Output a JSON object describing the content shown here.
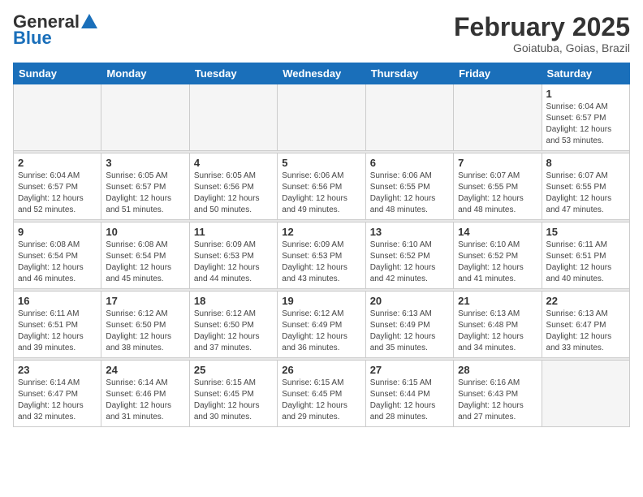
{
  "header": {
    "logo_general": "General",
    "logo_blue": "Blue",
    "month_title": "February 2025",
    "location": "Goiatuba, Goias, Brazil"
  },
  "weekdays": [
    "Sunday",
    "Monday",
    "Tuesday",
    "Wednesday",
    "Thursday",
    "Friday",
    "Saturday"
  ],
  "weeks": [
    [
      {
        "day": "",
        "info": ""
      },
      {
        "day": "",
        "info": ""
      },
      {
        "day": "",
        "info": ""
      },
      {
        "day": "",
        "info": ""
      },
      {
        "day": "",
        "info": ""
      },
      {
        "day": "",
        "info": ""
      },
      {
        "day": "1",
        "info": "Sunrise: 6:04 AM\nSunset: 6:57 PM\nDaylight: 12 hours and 53 minutes."
      }
    ],
    [
      {
        "day": "2",
        "info": "Sunrise: 6:04 AM\nSunset: 6:57 PM\nDaylight: 12 hours and 52 minutes."
      },
      {
        "day": "3",
        "info": "Sunrise: 6:05 AM\nSunset: 6:57 PM\nDaylight: 12 hours and 51 minutes."
      },
      {
        "day": "4",
        "info": "Sunrise: 6:05 AM\nSunset: 6:56 PM\nDaylight: 12 hours and 50 minutes."
      },
      {
        "day": "5",
        "info": "Sunrise: 6:06 AM\nSunset: 6:56 PM\nDaylight: 12 hours and 49 minutes."
      },
      {
        "day": "6",
        "info": "Sunrise: 6:06 AM\nSunset: 6:55 PM\nDaylight: 12 hours and 48 minutes."
      },
      {
        "day": "7",
        "info": "Sunrise: 6:07 AM\nSunset: 6:55 PM\nDaylight: 12 hours and 48 minutes."
      },
      {
        "day": "8",
        "info": "Sunrise: 6:07 AM\nSunset: 6:55 PM\nDaylight: 12 hours and 47 minutes."
      }
    ],
    [
      {
        "day": "9",
        "info": "Sunrise: 6:08 AM\nSunset: 6:54 PM\nDaylight: 12 hours and 46 minutes."
      },
      {
        "day": "10",
        "info": "Sunrise: 6:08 AM\nSunset: 6:54 PM\nDaylight: 12 hours and 45 minutes."
      },
      {
        "day": "11",
        "info": "Sunrise: 6:09 AM\nSunset: 6:53 PM\nDaylight: 12 hours and 44 minutes."
      },
      {
        "day": "12",
        "info": "Sunrise: 6:09 AM\nSunset: 6:53 PM\nDaylight: 12 hours and 43 minutes."
      },
      {
        "day": "13",
        "info": "Sunrise: 6:10 AM\nSunset: 6:52 PM\nDaylight: 12 hours and 42 minutes."
      },
      {
        "day": "14",
        "info": "Sunrise: 6:10 AM\nSunset: 6:52 PM\nDaylight: 12 hours and 41 minutes."
      },
      {
        "day": "15",
        "info": "Sunrise: 6:11 AM\nSunset: 6:51 PM\nDaylight: 12 hours and 40 minutes."
      }
    ],
    [
      {
        "day": "16",
        "info": "Sunrise: 6:11 AM\nSunset: 6:51 PM\nDaylight: 12 hours and 39 minutes."
      },
      {
        "day": "17",
        "info": "Sunrise: 6:12 AM\nSunset: 6:50 PM\nDaylight: 12 hours and 38 minutes."
      },
      {
        "day": "18",
        "info": "Sunrise: 6:12 AM\nSunset: 6:50 PM\nDaylight: 12 hours and 37 minutes."
      },
      {
        "day": "19",
        "info": "Sunrise: 6:12 AM\nSunset: 6:49 PM\nDaylight: 12 hours and 36 minutes."
      },
      {
        "day": "20",
        "info": "Sunrise: 6:13 AM\nSunset: 6:49 PM\nDaylight: 12 hours and 35 minutes."
      },
      {
        "day": "21",
        "info": "Sunrise: 6:13 AM\nSunset: 6:48 PM\nDaylight: 12 hours and 34 minutes."
      },
      {
        "day": "22",
        "info": "Sunrise: 6:13 AM\nSunset: 6:47 PM\nDaylight: 12 hours and 33 minutes."
      }
    ],
    [
      {
        "day": "23",
        "info": "Sunrise: 6:14 AM\nSunset: 6:47 PM\nDaylight: 12 hours and 32 minutes."
      },
      {
        "day": "24",
        "info": "Sunrise: 6:14 AM\nSunset: 6:46 PM\nDaylight: 12 hours and 31 minutes."
      },
      {
        "day": "25",
        "info": "Sunrise: 6:15 AM\nSunset: 6:45 PM\nDaylight: 12 hours and 30 minutes."
      },
      {
        "day": "26",
        "info": "Sunrise: 6:15 AM\nSunset: 6:45 PM\nDaylight: 12 hours and 29 minutes."
      },
      {
        "day": "27",
        "info": "Sunrise: 6:15 AM\nSunset: 6:44 PM\nDaylight: 12 hours and 28 minutes."
      },
      {
        "day": "28",
        "info": "Sunrise: 6:16 AM\nSunset: 6:43 PM\nDaylight: 12 hours and 27 minutes."
      },
      {
        "day": "",
        "info": ""
      }
    ]
  ]
}
